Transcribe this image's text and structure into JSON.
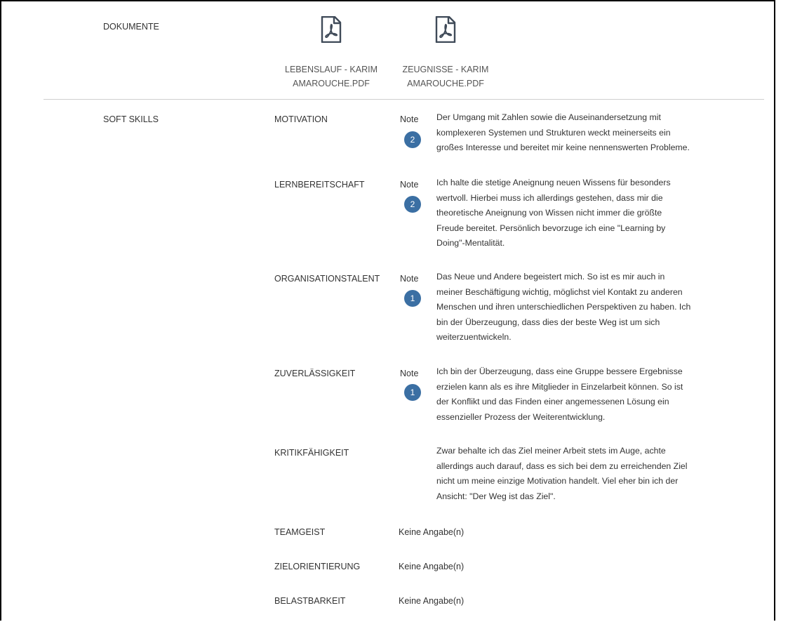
{
  "documents": {
    "heading": "DOKUMENTE",
    "files": [
      {
        "line1": "LEBENSLAUF - KARIM",
        "line2": "AMAROUCHE.PDF",
        "icon": "pdf-icon"
      },
      {
        "line1": "ZEUGNISSE - KARIM",
        "line2": "AMAROUCHE.PDF",
        "icon": "pdf-icon"
      }
    ]
  },
  "soft_skills": {
    "heading": "SOFT SKILLS",
    "note_label": "Note",
    "skills": [
      {
        "name": "MOTIVATION",
        "grade": "2",
        "text": [
          "Der Umgang mit Zahlen sowie die Auseinandersetzung mit",
          "komplexeren Systemen und Strukturen weckt meinerseits ein",
          "großes Interesse und bereitet mir keine nennenswerten Probleme."
        ]
      },
      {
        "name": "LERNBEREITSCHAFT",
        "grade": "2",
        "text": [
          "Ich halte die stetige Aneignung neuen Wissens für besonders",
          "wertvoll. Hierbei muss ich allerdings gestehen, dass mir die",
          "theoretische Aneignung von Wissen nicht immer die größte",
          "Freude bereitet. Persönlich bevorzuge ich eine \"Learning by",
          "Doing\"-Mentalität."
        ]
      },
      {
        "name": "ORGANISATIONSTALENT",
        "grade": "1",
        "text": [
          "Das Neue und Andere begeistert mich. So ist es mir auch in",
          "meiner Beschäftigung wichtig, möglichst viel Kontakt zu anderen",
          "Menschen und ihren unterschiedlichen Perspektiven zu haben. Ich",
          "bin der Überzeugung, dass dies der beste Weg ist um sich",
          "weiterzuentwickeln."
        ]
      },
      {
        "name": "ZUVERLÄSSIGKEIT",
        "grade": "1",
        "text": [
          "Ich bin der Überzeugung, dass eine Gruppe bessere Ergebnisse",
          "erzielen kann als es ihre Mitglieder in Einzelarbeit können. So ist",
          "der Konflikt und das Finden einer angemessenen Lösung ein",
          "essenzieller Prozess der Weiterentwicklung."
        ]
      },
      {
        "name": "KRITIKFÄHIGKEIT",
        "text": [
          "Zwar behalte ich das Ziel meiner Arbeit stets im Auge, achte",
          "allerdings auch darauf, dass es sich bei dem zu erreichenden Ziel",
          "nicht um meine einzige Motivation handelt. Viel eher bin ich der",
          "Ansicht: \"Der Weg ist das Ziel\"."
        ]
      },
      {
        "name": "TEAMGEIST",
        "value": "Keine Angabe(n)"
      },
      {
        "name": "ZIELORIENTIERUNG",
        "value": "Keine Angabe(n)"
      },
      {
        "name": "BELASTBARKEIT",
        "value": "Keine Angabe(n)"
      }
    ]
  },
  "colors": {
    "badge": "#3b6fa3",
    "divider": "#cfcfcf",
    "text": "#333333",
    "icon": "#3f4a58"
  }
}
